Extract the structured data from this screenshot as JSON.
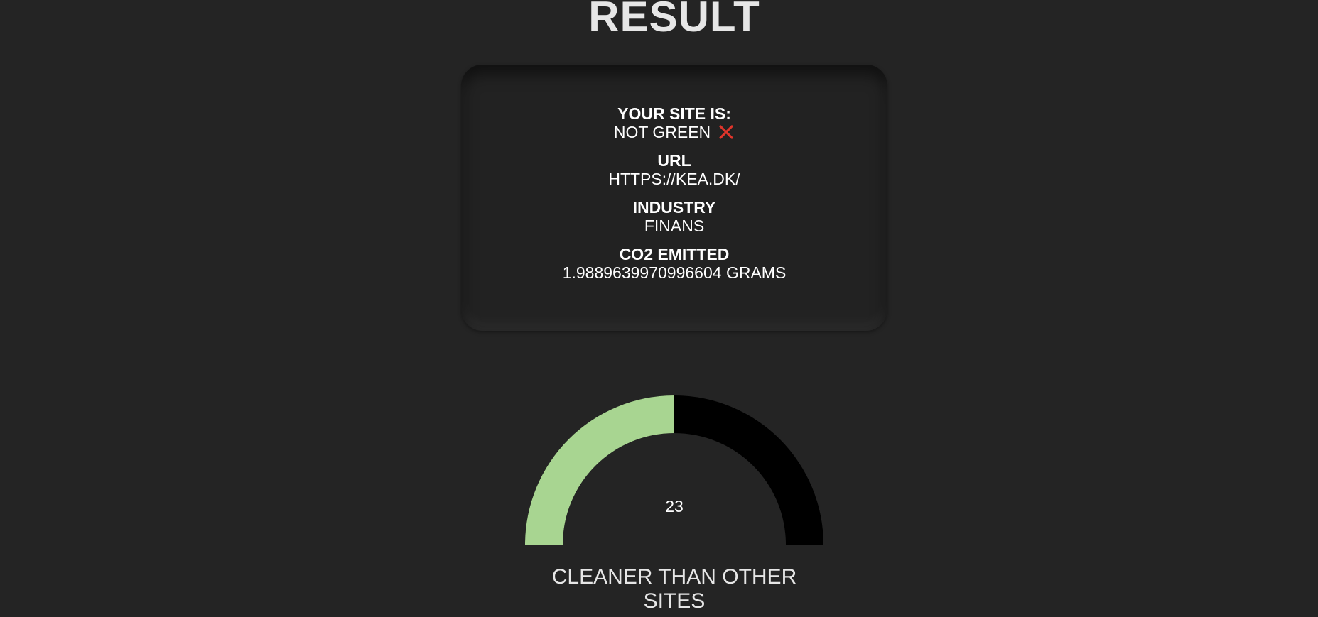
{
  "page": {
    "title": "RESULT"
  },
  "summary": {
    "status_label": "YOUR SITE IS:",
    "status_value": "NOT GREEN",
    "status_icon": "red-x-icon",
    "url_label": "URL",
    "url_value": "HTTPS://KEA.DK/",
    "industry_label": "INDUSTRY",
    "industry_value": "FINANS",
    "co2_label": "CO2 EMITTED",
    "co2_value": "1.9889639970996604 GRAMS"
  },
  "gauge": {
    "value": "23",
    "percent": 50,
    "fill_color": "#a8d591",
    "track_color": "#000000",
    "caption": "CLEANER THAN OTHER SITES"
  },
  "colors": {
    "background": "#242424",
    "accent_red": "#e0352b"
  }
}
